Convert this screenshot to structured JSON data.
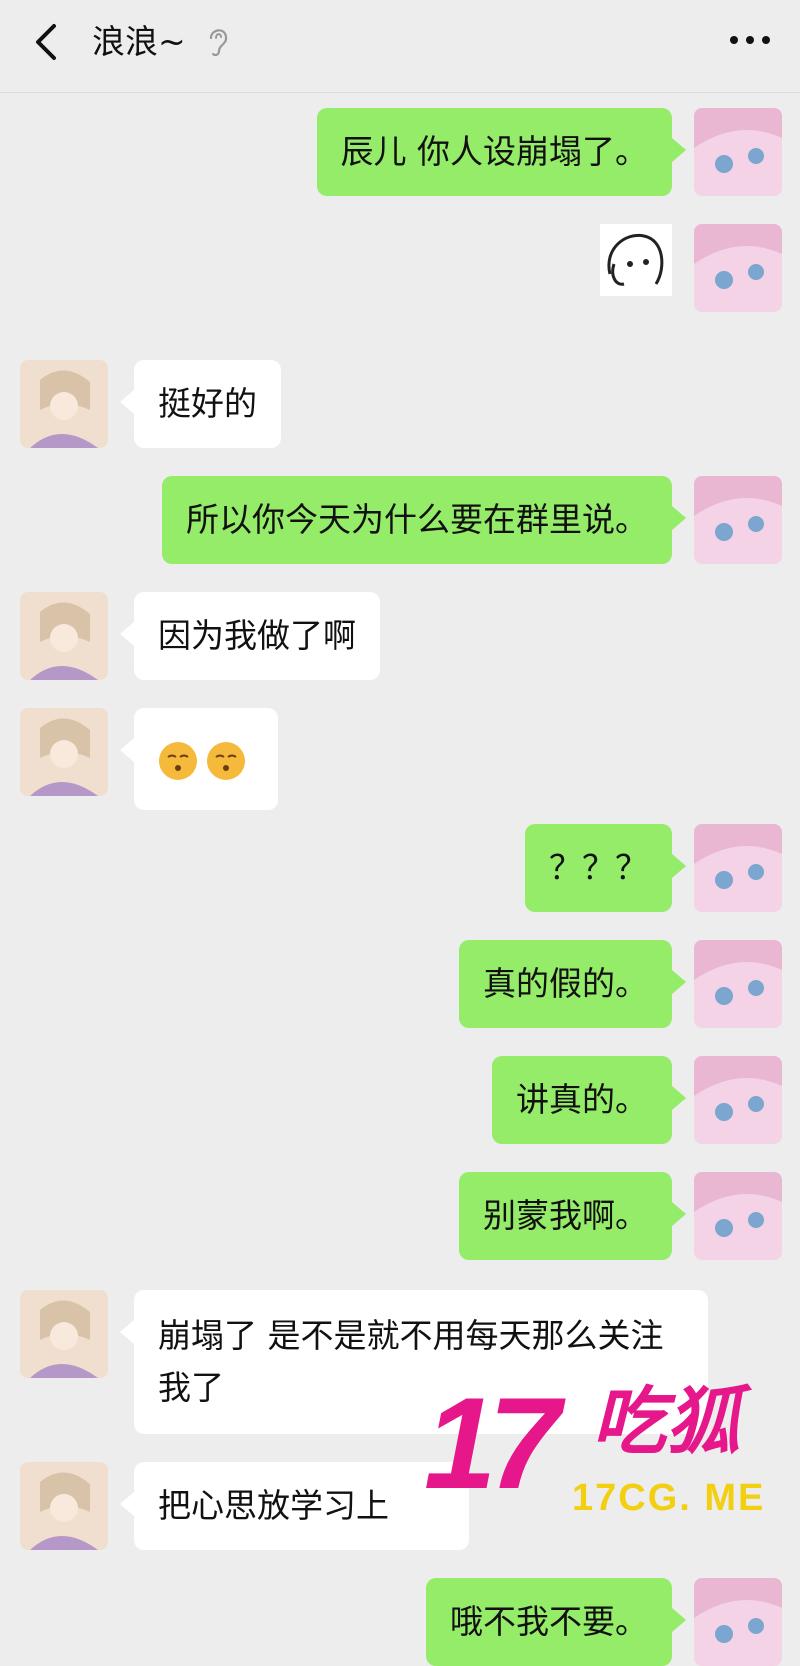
{
  "header": {
    "title": "浪浪~",
    "icons": {
      "back": "chevron-left-icon",
      "ear": "ear-icon",
      "more": "more-dots-icon"
    }
  },
  "colors": {
    "my_bubble": "#95ec69",
    "their_bubble": "#ffffff",
    "background": "#ededed",
    "watermark": "#e6178a",
    "watermark_url": "#f2d011"
  },
  "messages": [
    {
      "side": "me",
      "type": "text",
      "text": "辰儿  你人设崩塌了。"
    },
    {
      "side": "me",
      "type": "sticker",
      "sticker": "sketch-face-sticker"
    },
    {
      "side": "other",
      "type": "text",
      "text": "挺好的"
    },
    {
      "side": "me",
      "type": "text",
      "text": "所以你今天为什么要在群里说。"
    },
    {
      "side": "other",
      "type": "text",
      "text": "因为我做了啊"
    },
    {
      "side": "other",
      "type": "emoji",
      "emoji": [
        "kissing-face-icon",
        "kissing-face-icon"
      ]
    },
    {
      "side": "me",
      "type": "text",
      "text": "？？？"
    },
    {
      "side": "me",
      "type": "text",
      "text": "真的假的。"
    },
    {
      "side": "me",
      "type": "text",
      "text": "讲真的。"
    },
    {
      "side": "me",
      "type": "text",
      "text": "别蒙我啊。"
    },
    {
      "side": "other",
      "type": "text",
      "text": "崩塌了 是不是就不用每天那么关注我了"
    },
    {
      "side": "other",
      "type": "text",
      "text": "把心思放学习上"
    },
    {
      "side": "me",
      "type": "text",
      "text": "哦不我不要。"
    }
  ],
  "watermark": {
    "number": "17",
    "text": "吃狐",
    "url": "17CG. ME"
  }
}
